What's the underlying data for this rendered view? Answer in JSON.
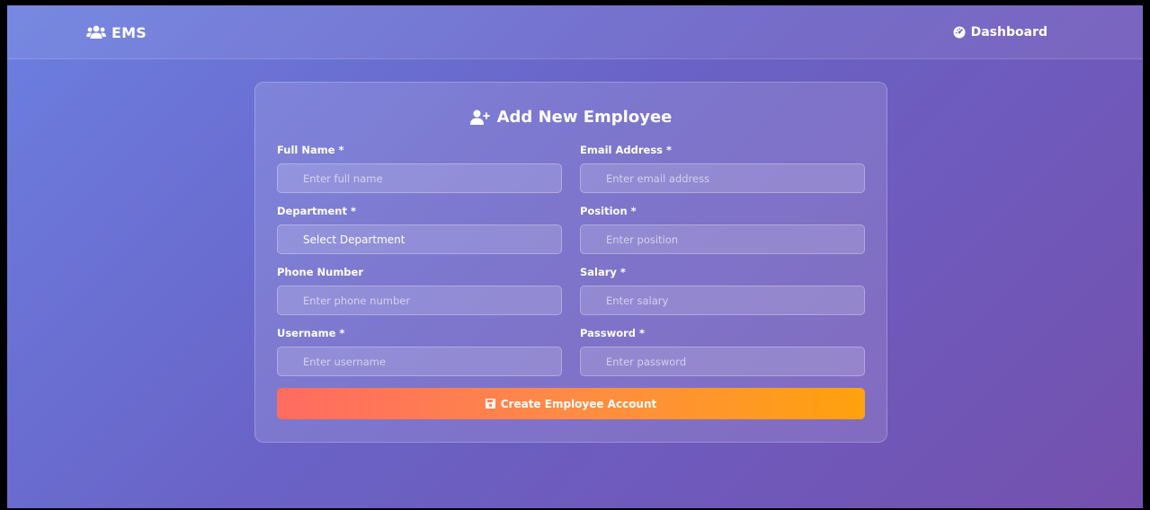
{
  "navbar": {
    "brand": {
      "icon": "users-icon",
      "label": "EMS"
    },
    "dashboard": {
      "icon": "gauge-icon",
      "label": "Dashboard"
    }
  },
  "form": {
    "title": "Add New Employee",
    "title_icon": "user-plus-icon",
    "fields": {
      "full_name": {
        "label": "Full Name *",
        "placeholder": "Enter full name"
      },
      "email": {
        "label": "Email Address *",
        "placeholder": "Enter email address"
      },
      "department": {
        "label": "Department *",
        "value": "Select Department"
      },
      "position": {
        "label": "Position *",
        "placeholder": "Enter position"
      },
      "phone": {
        "label": "Phone Number",
        "placeholder": "Enter phone number"
      },
      "salary": {
        "label": "Salary *",
        "placeholder": "Enter salary"
      },
      "username": {
        "label": "Username *",
        "placeholder": "Enter username"
      },
      "password": {
        "label": "Password *",
        "placeholder": "Enter password"
      }
    },
    "submit": {
      "icon": "save-icon",
      "label": "Create Employee Account"
    }
  },
  "colors": {
    "bg_start": "#6b7fe0",
    "bg_end": "#7450ae",
    "button_start": "#ff6b61",
    "button_end": "#ffa20c"
  }
}
